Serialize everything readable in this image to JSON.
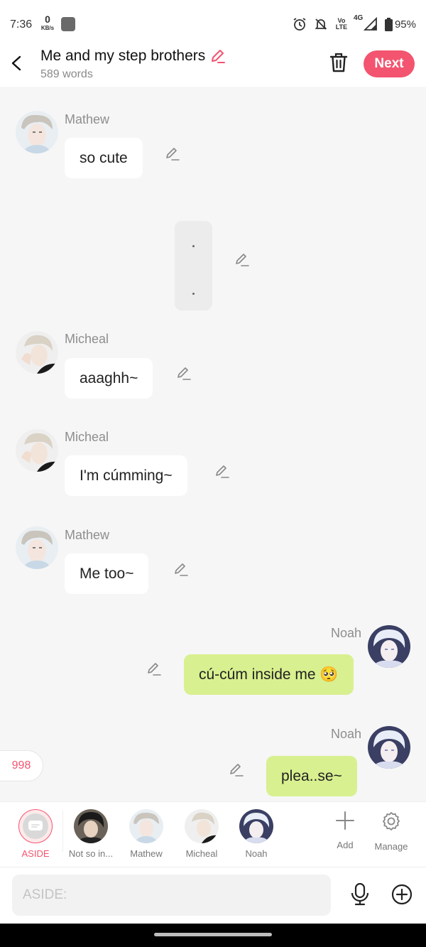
{
  "status_bar": {
    "time": "7:36",
    "net_speed_value": "0",
    "net_speed_unit": "KB/s",
    "volte_label": "Vo LTE",
    "network": "4G",
    "battery": "95%"
  },
  "header": {
    "title": "Me and my step brothers",
    "word_count": "589 words",
    "next_label": "Next"
  },
  "messages": [
    {
      "sender": "Mathew",
      "text": "so cute",
      "side": "left"
    },
    {
      "sender": "",
      "text": "",
      "side": "center"
    },
    {
      "sender": "Micheal",
      "text": "aaaghh~",
      "side": "left"
    },
    {
      "sender": "Micheal",
      "text": "I'm cúmming~",
      "side": "left"
    },
    {
      "sender": "Mathew",
      "text": "Me too~",
      "side": "left"
    },
    {
      "sender": "Noah",
      "text": "cú-cúm inside me 🥺",
      "side": "right"
    },
    {
      "sender": "Noah",
      "text": "plea..se~",
      "side": "right"
    }
  ],
  "remaining_count": "998",
  "characters": [
    {
      "label": "ASIDE",
      "selected": true
    },
    {
      "label": "Not so in..."
    },
    {
      "label": "Mathew"
    },
    {
      "label": "Micheal"
    },
    {
      "label": "Noah"
    }
  ],
  "tools": {
    "add_label": "Add",
    "manage_label": "Manage"
  },
  "input": {
    "placeholder": "ASIDE:"
  },
  "colors": {
    "accent": "#f3546f",
    "my_bubble": "#d8f08f",
    "background": "#f6f6f6"
  }
}
